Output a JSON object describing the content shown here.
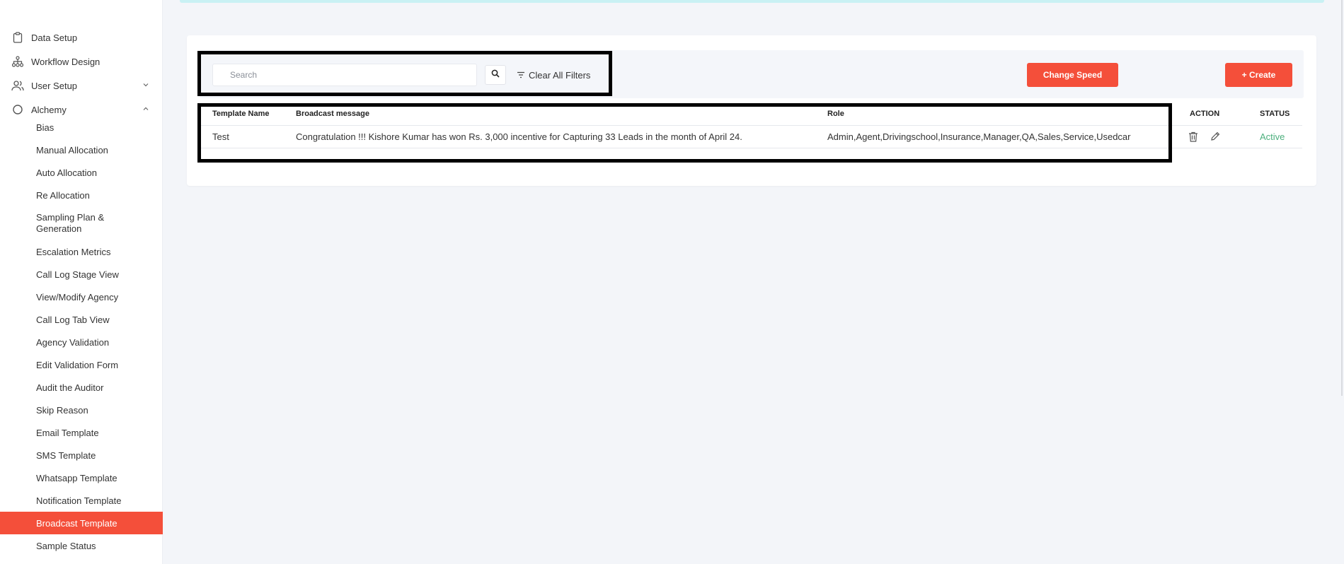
{
  "sidebar": {
    "items": [
      {
        "label": "Data Setup",
        "icon": "clipboard-icon"
      },
      {
        "label": "Workflow Design",
        "icon": "sitemap-icon"
      },
      {
        "label": "User Setup",
        "icon": "users-icon"
      },
      {
        "label": "Alchemy",
        "icon": "circle-icon"
      }
    ],
    "sub_items": [
      "Bias",
      "Manual Allocation",
      "Auto Allocation",
      "Re Allocation",
      "Sampling Plan & Generation",
      "Escalation Metrics",
      "Call Log Stage View",
      "View/Modify Agency",
      "Call Log Tab View",
      "Agency Validation",
      "Edit Validation Form",
      "Audit the Auditor",
      "Skip Reason",
      "Email Template",
      "SMS Template",
      "Whatsapp Template",
      "Notification Template",
      "Broadcast Template",
      "Sample Status"
    ],
    "active_item": "Broadcast Template"
  },
  "toolbar": {
    "search_placeholder": "Search",
    "clear_filters_label": "Clear All Filters",
    "change_speed_label": "Change Speed",
    "create_label": "+ Create"
  },
  "table": {
    "headers": [
      "Template Name",
      "Broadcast message",
      "Role",
      "ACTION",
      "STATUS"
    ],
    "rows": [
      {
        "template_name": "Test",
        "broadcast_message": "Congratulation !!! Kishore Kumar has won Rs. 3,000 incentive for Capturing 33 Leads in the month of April 24.",
        "role": "Admin,Agent,Drivingschool,Insurance,Manager,QA,Sales,Service,Usedcar",
        "status": "Active"
      }
    ]
  },
  "colors": {
    "accent": "#f44f3a",
    "status_active": "#4caf7d",
    "top_strip": "#c9f1f4"
  }
}
